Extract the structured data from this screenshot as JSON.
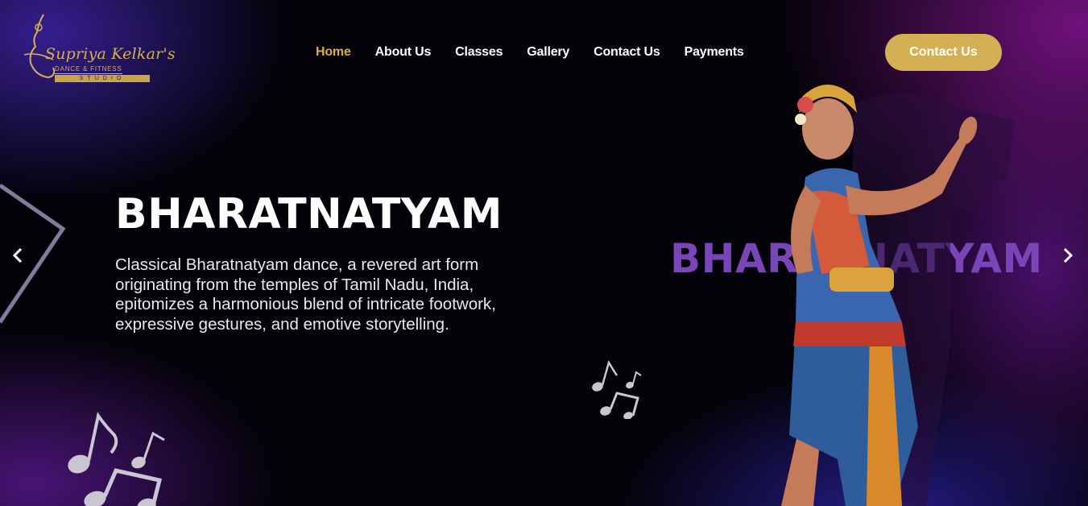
{
  "logo": {
    "script_text": "Supriya Kelkar's",
    "subtitle": "DANCE & FITNESS",
    "studio": "STUDIO"
  },
  "nav": {
    "items": [
      {
        "label": "Home",
        "active": true
      },
      {
        "label": "About Us",
        "active": false
      },
      {
        "label": "Classes",
        "active": false
      },
      {
        "label": "Gallery",
        "active": false
      },
      {
        "label": "Contact Us",
        "active": false
      },
      {
        "label": "Payments",
        "active": false
      }
    ]
  },
  "cta": {
    "label": "Contact Us"
  },
  "hero": {
    "headline": "BHARATNATYAM",
    "description": "Classical Bharatnatyam dance, a revered art form originating from the temples of Tamil Nadu, India, epitomizes a harmonious blend of intricate footwork, expressive gestures, and emotive storytelling.",
    "background_word": "BHARATNATYAM"
  },
  "carousel": {
    "prev_icon": "chevron-left-icon",
    "next_icon": "chevron-right-icon"
  },
  "colors": {
    "accent_gold": "#d4af53",
    "purple_text": "#7a45b8",
    "background": "#030208"
  }
}
